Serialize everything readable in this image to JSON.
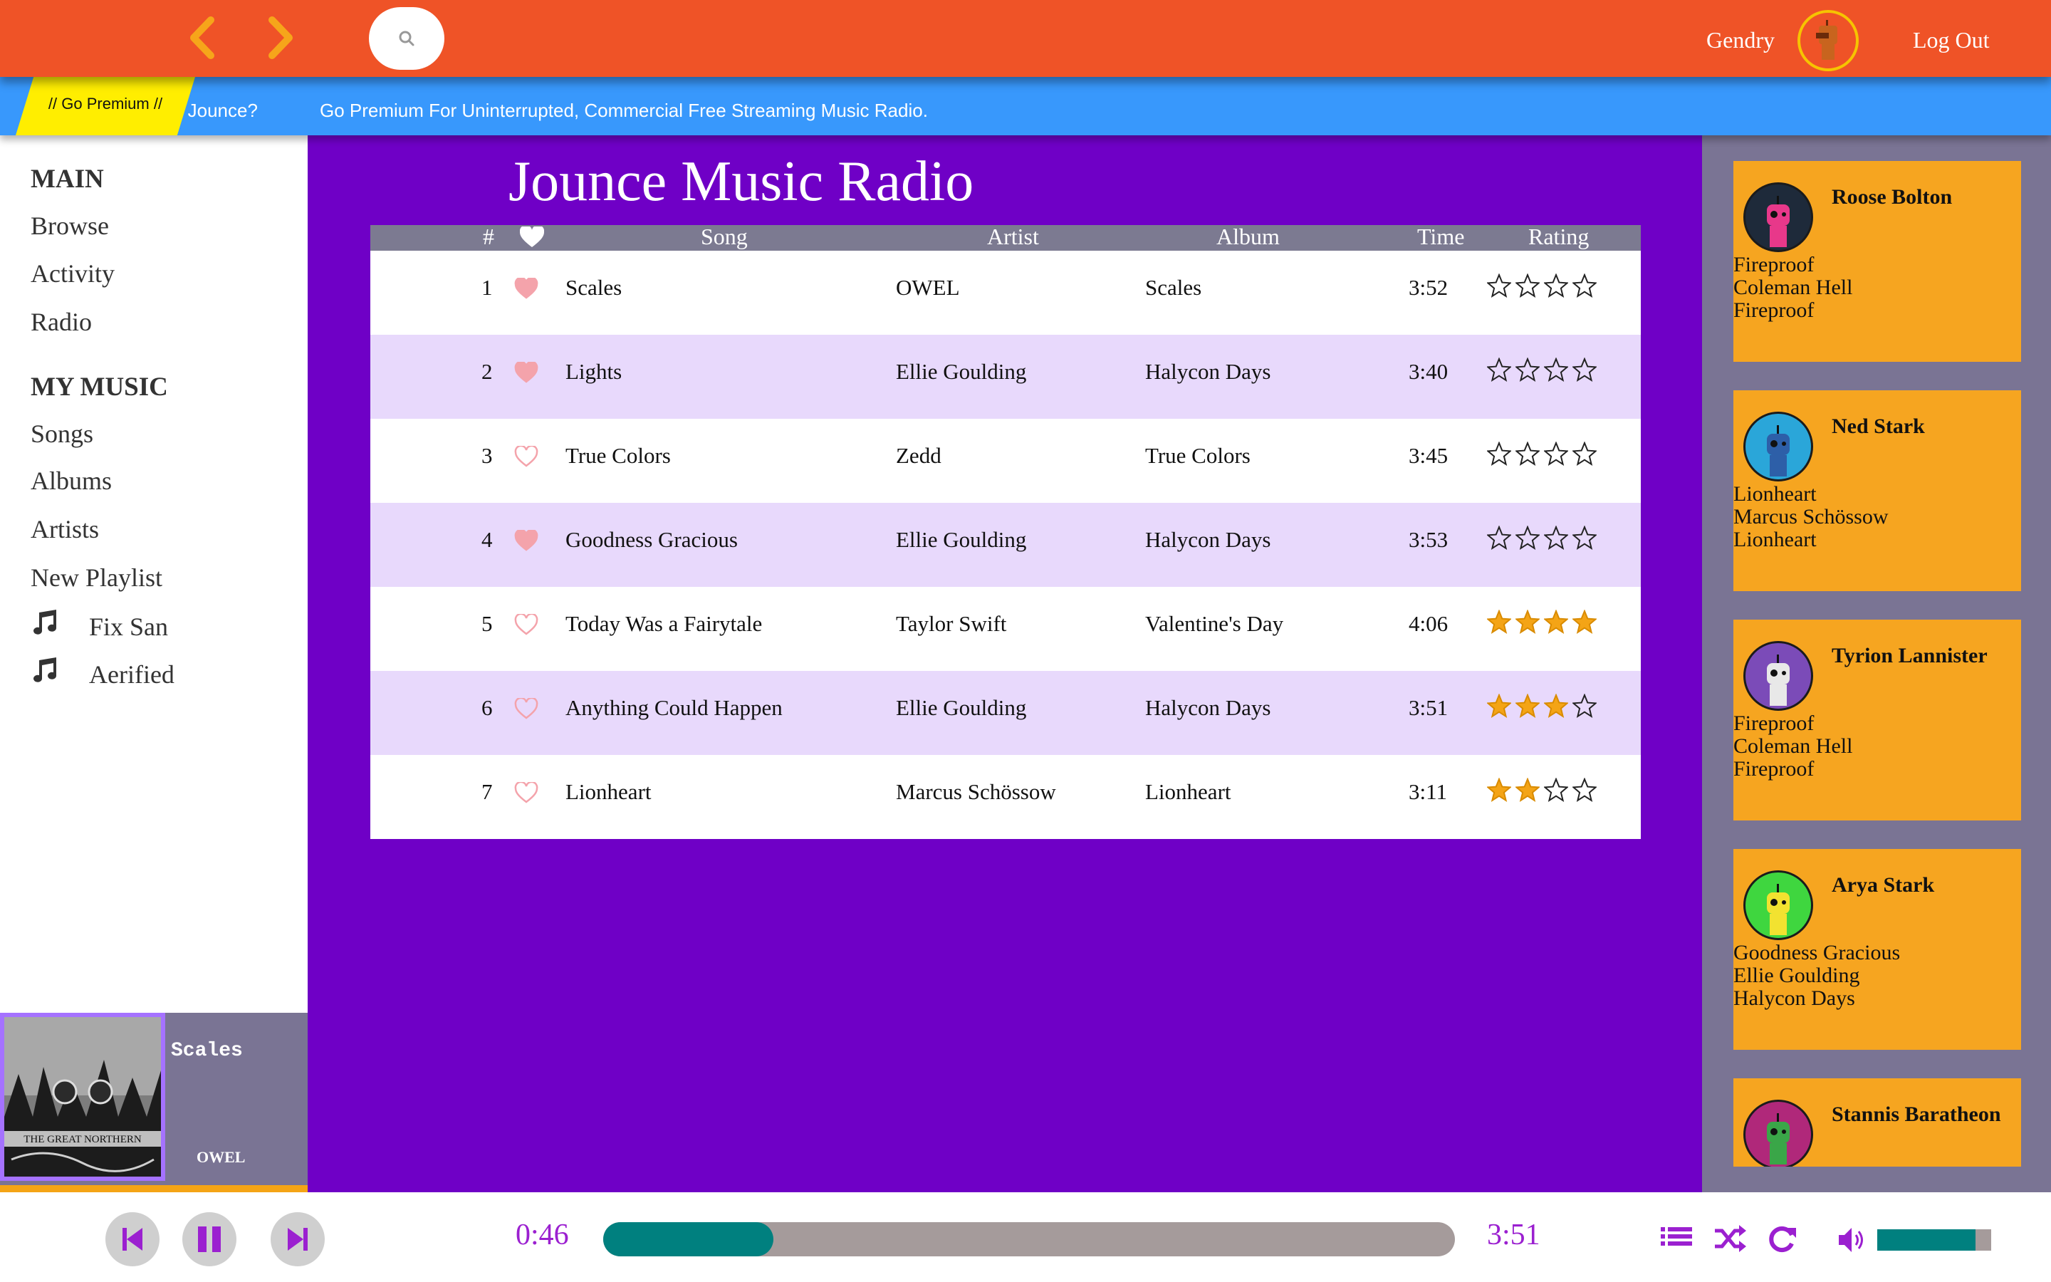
{
  "header": {
    "back_icon": "chevron-left-icon",
    "forward_icon": "chevron-right-icon",
    "search_icon": "search-icon",
    "username": "Gendry",
    "logout_label": "Log Out",
    "accent_color": "#ef5327"
  },
  "promo": {
    "badge": "// Go Premium //",
    "question": "Love Jounce?",
    "message": "Go Premium For Uninterrupted, Commercial Free Streaming Music Radio."
  },
  "sidebar": {
    "main_heading": "MAIN",
    "main_items": [
      "Browse",
      "Activity",
      "Radio"
    ],
    "mymusic_heading": "MY MUSIC",
    "mymusic_items": [
      "Songs",
      "Albums",
      "Artists",
      "New Playlist"
    ],
    "playlists": [
      "Fix San",
      "Aerified"
    ]
  },
  "now_playing": {
    "title": "Scales",
    "artist": "OWEL",
    "album_art_text": "THE GREAT NORTHERN",
    "progress_fraction": 1.0
  },
  "main": {
    "title": "Jounce Music Radio",
    "columns": {
      "number": "#",
      "favorite_icon": "heart-icon",
      "song": "Song",
      "artist": "Artist",
      "album": "Album",
      "time": "Time",
      "rating": "Rating"
    },
    "tracks": [
      {
        "num": "1",
        "song": "Scales",
        "artist": "OWEL",
        "album": "Scales",
        "time": "3:52",
        "liked": true,
        "rating": 0
      },
      {
        "num": "2",
        "song": "Lights",
        "artist": "Ellie Goulding",
        "album": "Halycon Days",
        "time": "3:40",
        "liked": true,
        "rating": 0
      },
      {
        "num": "3",
        "song": "True Colors",
        "artist": "Zedd",
        "album": "True Colors",
        "time": "3:45",
        "liked": false,
        "rating": 0
      },
      {
        "num": "4",
        "song": "Goodness Gracious",
        "artist": "Ellie Goulding",
        "album": "Halycon Days",
        "time": "3:53",
        "liked": true,
        "rating": 0
      },
      {
        "num": "5",
        "song": "Today Was a Fairytale",
        "artist": "Taylor Swift",
        "album": "Valentine's Day",
        "time": "4:06",
        "liked": false,
        "rating": 4
      },
      {
        "num": "6",
        "song": "Anything Could Happen",
        "artist": "Ellie Goulding",
        "album": "Halycon Days",
        "time": "3:51",
        "liked": false,
        "rating": 3
      },
      {
        "num": "7",
        "song": "Lionheart",
        "artist": "Marcus Schössow",
        "album": "Lionheart",
        "time": "3:11",
        "liked": false,
        "rating": 2
      }
    ]
  },
  "friends": [
    {
      "name": "Roose Bolton",
      "song": "Fireproof",
      "artist": "Coleman Hell",
      "album": "Fireproof",
      "avatar_color": "#1e2a3a",
      "robot_color": "#e8388a"
    },
    {
      "name": "Ned Stark",
      "song": "Lionheart",
      "artist": "Marcus Schössow",
      "album": "Lionheart",
      "avatar_color": "#2aa6d9",
      "robot_color": "#2d5fa8"
    },
    {
      "name": "Tyrion Lannister",
      "song": "Fireproof",
      "artist": "Coleman Hell",
      "album": "Fireproof",
      "avatar_color": "#7b4bb8",
      "robot_color": "#e8e8e8"
    },
    {
      "name": "Arya Stark",
      "song": "Goodness Gracious",
      "artist": "Ellie Goulding",
      "album": "Halycon Days",
      "avatar_color": "#3fd63f",
      "robot_color": "#f2e230"
    },
    {
      "name": "Stannis Baratheon",
      "song": "",
      "artist": "",
      "album": "",
      "avatar_color": "#b0287a",
      "robot_color": "#3aa648"
    }
  ],
  "player": {
    "prev_icon": "skip-back-icon",
    "pause_icon": "pause-icon",
    "next_icon": "skip-forward-icon",
    "elapsed": "0:46",
    "duration": "3:51",
    "progress_fraction": 0.2,
    "queue_icon": "list-icon",
    "shuffle_icon": "shuffle-icon",
    "repeat_icon": "repeat-icon",
    "volume_icon": "volume-icon",
    "volume_fraction": 0.86,
    "control_color": "#9b20d0",
    "accent_color": "#00807f"
  }
}
